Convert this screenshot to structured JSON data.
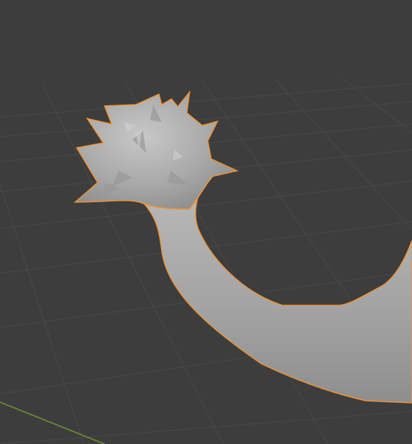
{
  "viewport": {
    "mode": "3D Viewport",
    "shading": "solid"
  },
  "scene": {
    "selected_object": {
      "shape": "curved tail with spiked ball tip",
      "state": "selected",
      "outline_color": "#f0922f",
      "surface_color": "#a9a9a9"
    },
    "floor_grid": {
      "visible": true,
      "line_color": "#4a4a4a"
    },
    "x_axis_line": {
      "visible": true,
      "color": "#6f9c2e"
    }
  },
  "colors": {
    "background": "#3d3d3d",
    "selection_outline": "#f0922f",
    "mesh_shade": "#a9a9a9"
  }
}
